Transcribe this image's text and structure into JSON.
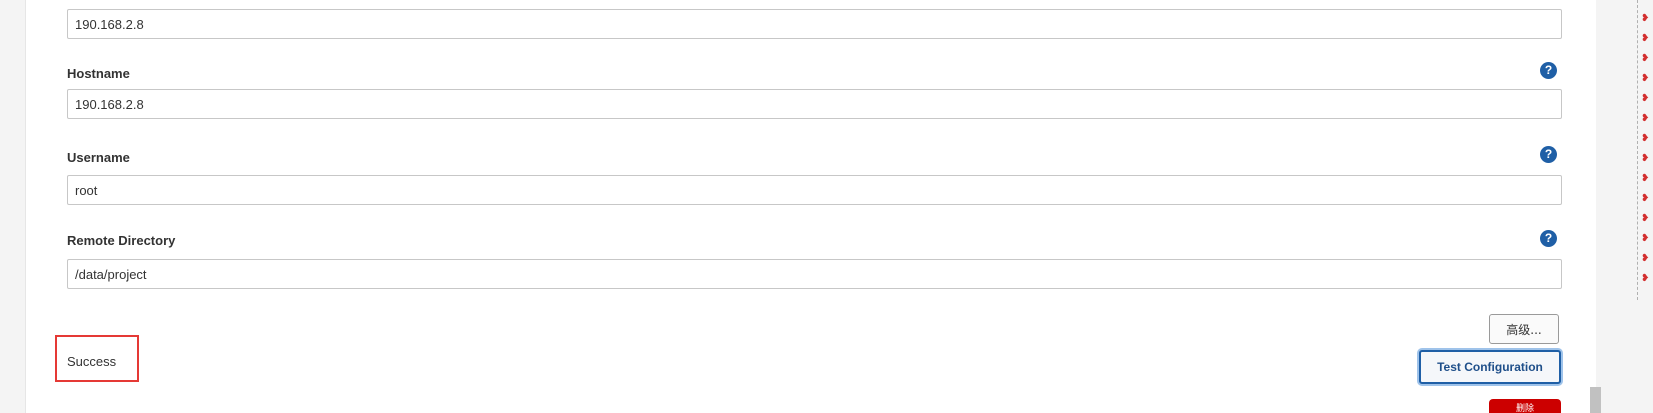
{
  "fields": {
    "ip": {
      "value": "190.168.2.8"
    },
    "hostname": {
      "label": "Hostname",
      "value": "190.168.2.8",
      "help": "?"
    },
    "username": {
      "label": "Username",
      "value": "root",
      "help": "?"
    },
    "remote_directory": {
      "label": "Remote Directory",
      "value": "/data/project",
      "help": "?"
    }
  },
  "status": {
    "text": "Success"
  },
  "buttons": {
    "advanced": "高级...",
    "test_configuration": "Test Configuration",
    "delete": "删除"
  },
  "side_strip": {
    "mark": "❥"
  },
  "colors": {
    "accent": "#1f5fa6",
    "danger": "#cc0000",
    "highlight_border": "#e53935"
  }
}
